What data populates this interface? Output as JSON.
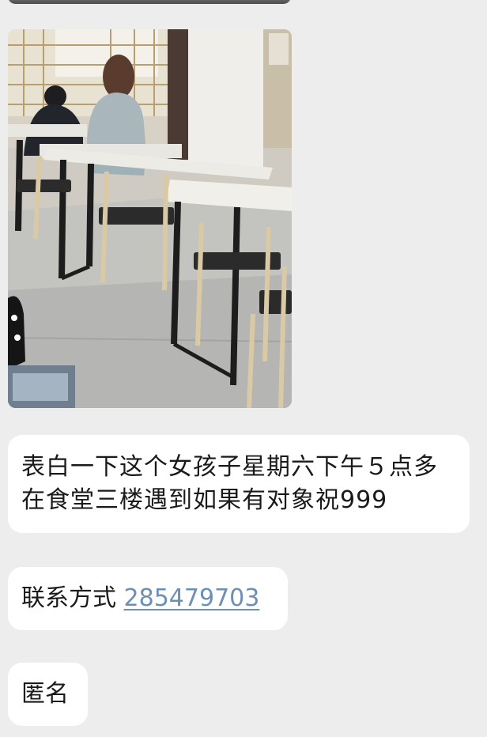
{
  "messages": [
    {
      "type": "image",
      "description_icon": "photo-message"
    },
    {
      "type": "text",
      "text": "表白一下这个女孩子星期六下午５点多在食堂三楼遇到如果有对象祝999"
    },
    {
      "type": "text",
      "prefix": "联系方式 ",
      "link": "285479703"
    },
    {
      "type": "text",
      "text": "匿名"
    }
  ],
  "colors": {
    "background": "#ededed",
    "bubble": "#ffffff",
    "text": "#1a1a1a",
    "link": "#6b8fb5"
  }
}
